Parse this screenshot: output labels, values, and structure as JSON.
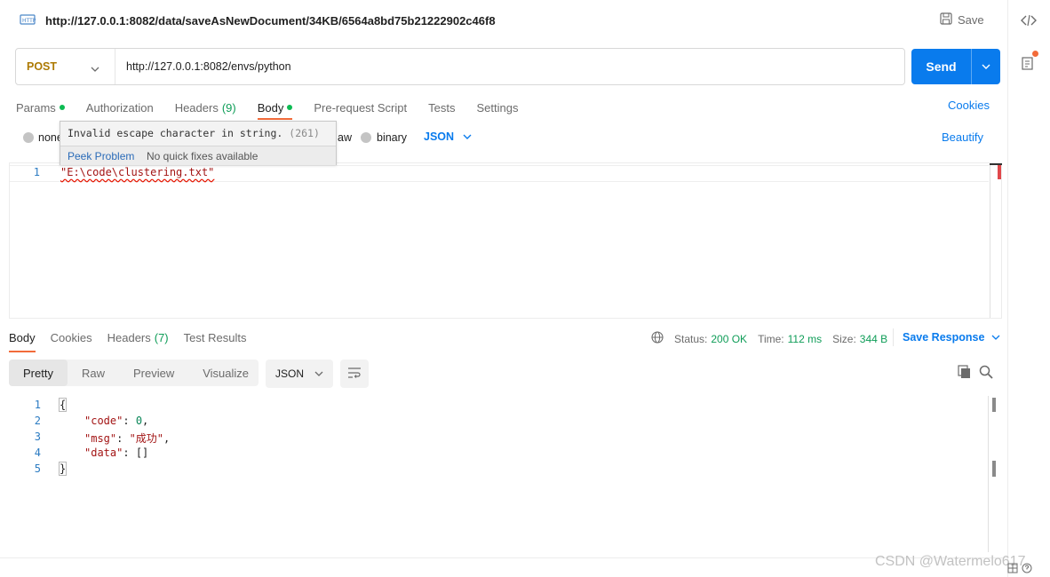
{
  "header": {
    "title": "http://127.0.0.1:8082/data/saveAsNewDocument/34KB/6564a8bd75b21222902c46f8",
    "save_label": "Save"
  },
  "request": {
    "method": "POST",
    "url": "http://127.0.0.1:8082/envs/python",
    "send_label": "Send",
    "tabs": [
      {
        "label": "Params",
        "has_dot": true
      },
      {
        "label": "Authorization"
      },
      {
        "label": "Headers",
        "count": "(9)"
      },
      {
        "label": "Body",
        "has_dot": true,
        "active": true
      },
      {
        "label": "Pre-request Script"
      },
      {
        "label": "Tests"
      },
      {
        "label": "Settings"
      }
    ],
    "cookies_label": "Cookies",
    "body_types": {
      "none": "none",
      "raw_fragment": "aw",
      "binary": "binary",
      "format": "JSON"
    },
    "beautify_label": "Beautify",
    "editor_line_number": "1",
    "editor_text": "\"E:\\code\\clustering.txt\""
  },
  "tooltip": {
    "message": "Invalid escape character in string.",
    "code": "(261)",
    "peek_label": "Peek Problem",
    "no_fix": "No quick fixes available"
  },
  "response": {
    "tabs": [
      {
        "label": "Body",
        "active": true
      },
      {
        "label": "Cookies"
      },
      {
        "label": "Headers",
        "count": "(7)"
      },
      {
        "label": "Test Results"
      }
    ],
    "status_label": "Status:",
    "status_value": "200 OK",
    "time_label": "Time:",
    "time_value": "112 ms",
    "size_label": "Size:",
    "size_value": "344 B",
    "save_response_label": "Save Response",
    "views": [
      "Pretty",
      "Raw",
      "Preview",
      "Visualize"
    ],
    "active_view": "Pretty",
    "format": "JSON",
    "line_numbers": [
      "1",
      "2",
      "3",
      "4",
      "5"
    ],
    "lines": {
      "open": "{",
      "code_key": "\"code\"",
      "code_val": "0",
      "msg_key": "\"msg\"",
      "msg_val": "\"成功\"",
      "data_key": "\"data\"",
      "data_val": "[]",
      "close": "}"
    }
  },
  "watermark": "CSDN @Watermelo617",
  "colors": {
    "accent": "#097bed",
    "post_method": "#ad7a03",
    "active_tab_underline": "#f26b3a",
    "status_ok": "#0f9d58",
    "error_squiggle": "#e51400"
  },
  "icons": [
    "http-icon",
    "save-icon",
    "code-icon",
    "document-icon",
    "chevron-down-icon",
    "globe-icon",
    "copy-icon",
    "search-icon",
    "wrap-lines-icon"
  ]
}
